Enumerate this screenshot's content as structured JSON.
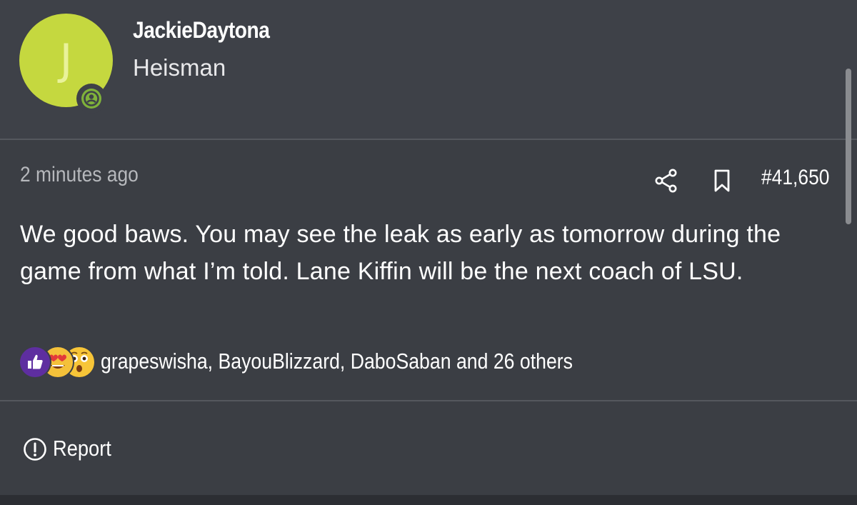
{
  "user": {
    "avatar_letter": "J",
    "avatar_color": "#c5d83f",
    "online_icon": "online-status-icon",
    "username": "JackieDaytona",
    "title": "Heisman"
  },
  "post": {
    "timestamp": "2 minutes ago",
    "share_icon": "share-icon",
    "bookmark_icon": "bookmark-icon",
    "post_number": "#41,650",
    "body": "We good baws. You may see the leak as early as tomorrow during the game from what I’m told. Lane Kiffin will be the next coach of LSU."
  },
  "reactions": {
    "icons": [
      "like-reaction-icon",
      "love-reaction-icon",
      "wow-reaction-icon"
    ],
    "summary": "grapeswisha, BayouBlizzard, DaboSaban and 26 others"
  },
  "actions": {
    "report_label": "Report",
    "report_icon": "alert-circle-icon"
  },
  "colors": {
    "background": "#3b3e44",
    "accent": "#c5d83f",
    "online": "#7fb23a",
    "like": "#5e2ea0"
  }
}
